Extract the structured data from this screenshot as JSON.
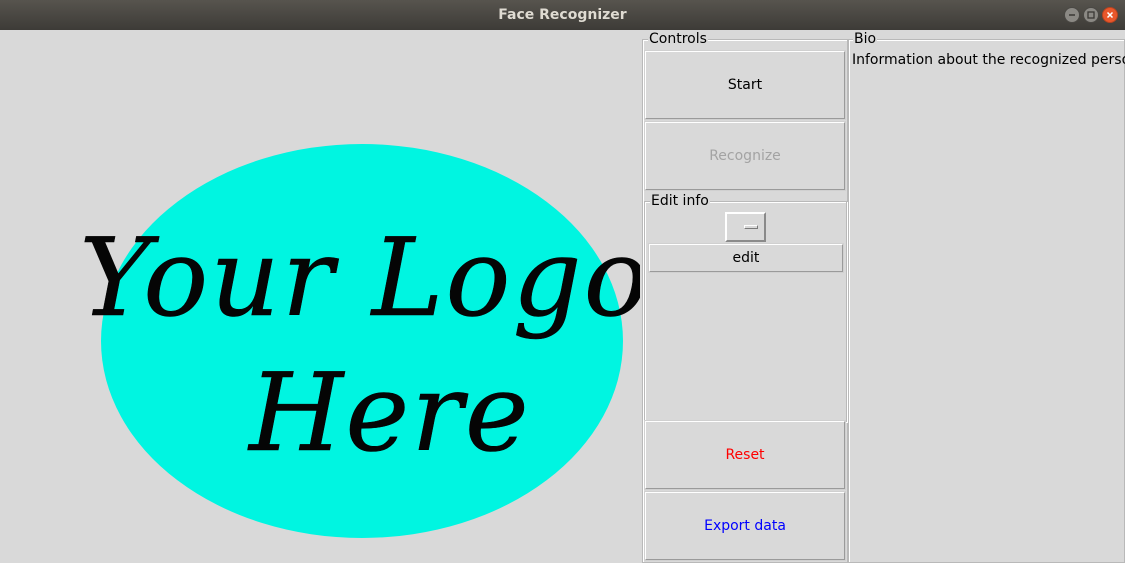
{
  "window": {
    "title": "Face Recognizer"
  },
  "logo": {
    "line1": "Your Logo",
    "line2": "Here",
    "ellipse_color": "#00f5e1"
  },
  "controls": {
    "label": "Controls",
    "start_label": "Start",
    "recognize_label": "Recognize",
    "reset_label": "Reset",
    "export_label": "Export data"
  },
  "edit_info": {
    "label": "Edit info",
    "selected_option": "",
    "edit_label": "edit"
  },
  "bio": {
    "label": "Bio",
    "text": "Information about the recognized person."
  },
  "colors": {
    "reset": "#ff0000",
    "export": "#0000ff",
    "disabled": "#a3a3a3"
  }
}
